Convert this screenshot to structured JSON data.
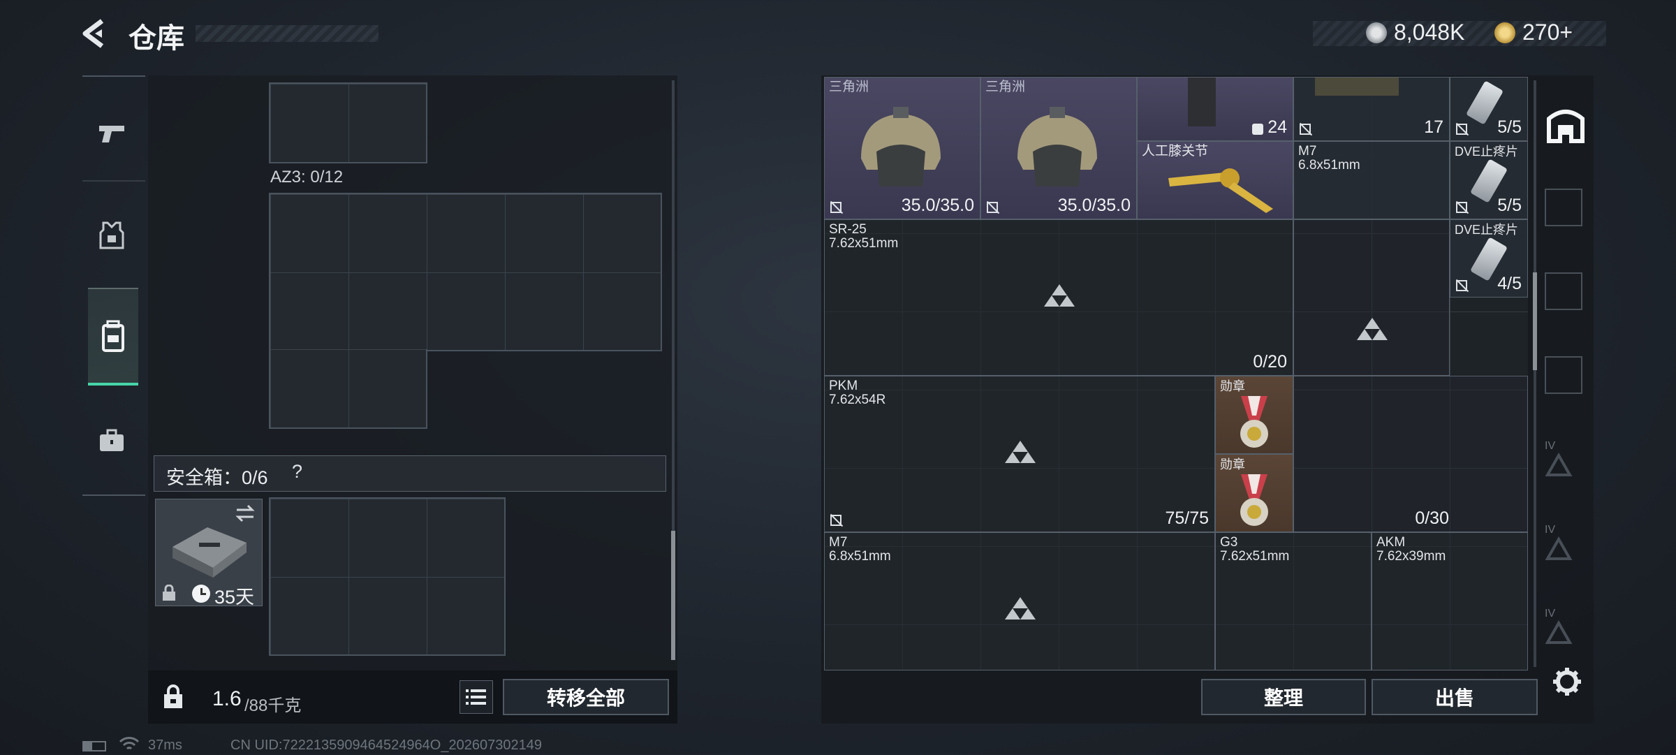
{
  "header": {
    "title": "仓库"
  },
  "currency": {
    "coins": "8,048K",
    "tickets": "270+"
  },
  "left_tabs": [
    "weapons",
    "armor",
    "backpack",
    "case"
  ],
  "container": {
    "name_label": "AZ3: 0/12"
  },
  "safe_box": {
    "label": "安全箱：0/6",
    "help": "?",
    "timer": "35天"
  },
  "weight": {
    "current": "1.6",
    "max": "/88千克"
  },
  "actions": {
    "transfer_all": "转移全部",
    "organize": "整理",
    "sell": "出售"
  },
  "status": {
    "ping": "37ms",
    "uid": "CN UID:7222135909464524964O_202607302149"
  },
  "warehouse": {
    "items": [
      {
        "id": "helmet1",
        "label": "三角洲",
        "count": "35.0/35.0"
      },
      {
        "id": "helmet2",
        "label": "三角洲",
        "count": "35.0/35.0"
      },
      {
        "id": "topA",
        "count": "24"
      },
      {
        "id": "topB",
        "count": "17"
      },
      {
        "id": "topC",
        "count": "5/5"
      },
      {
        "id": "knee",
        "label": "人工膝关节"
      },
      {
        "id": "m7a",
        "label": "M7\n6.8x51mm"
      },
      {
        "id": "dve1",
        "label": "DVE止疼片",
        "count": "5/5"
      },
      {
        "id": "sr25",
        "label": "SR-25\n7.62x51mm",
        "count": "0/20"
      },
      {
        "id": "dve2",
        "label": "DVE止疼片",
        "count": "4/5"
      },
      {
        "id": "pkm",
        "label": "PKM\n7.62x54R",
        "count": "75/75"
      },
      {
        "id": "medal1",
        "label": "勋章"
      },
      {
        "id": "medal2",
        "label": "勋章"
      },
      {
        "id": "box030",
        "count": "0/30"
      },
      {
        "id": "m7b",
        "label": "M7\n6.8x51mm"
      },
      {
        "id": "g3",
        "label": "G3\n7.62x51mm"
      },
      {
        "id": "akm",
        "label": "AKM\n7.62x39mm"
      }
    ]
  },
  "right_tabs": [
    "IV",
    "IV",
    "IV"
  ]
}
